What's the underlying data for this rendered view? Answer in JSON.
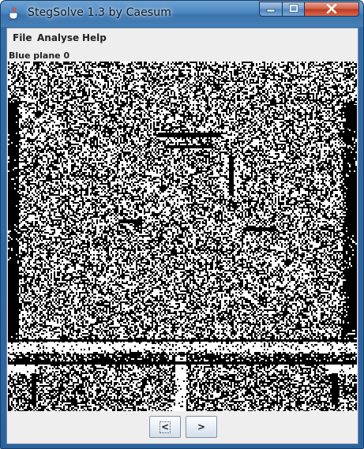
{
  "window": {
    "title": "StegSolve 1.3 by Caesum",
    "controls": {
      "minimize_glyph": "—",
      "maximize_glyph": "☐",
      "close_glyph": "✕"
    },
    "icons": {
      "app": "java-cup-icon"
    }
  },
  "menu": {
    "items": [
      {
        "label": "File"
      },
      {
        "label": "Analyse"
      },
      {
        "label": "Help"
      }
    ]
  },
  "status": {
    "label": "Blue plane 0"
  },
  "navigation": {
    "prev_label": "<",
    "next_label": ">"
  },
  "image": {
    "mode": "bit-plane noise",
    "colors": {
      "foreground": "#000000",
      "background": "#ffffff"
    }
  }
}
